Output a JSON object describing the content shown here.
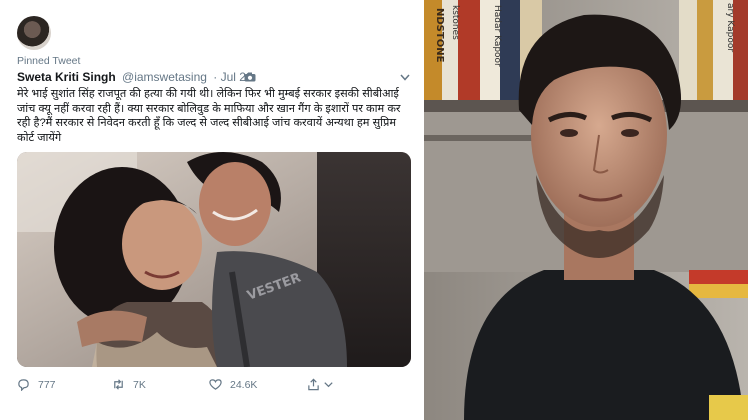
{
  "tweet": {
    "pinned_label": "Pinned Tweet",
    "author_name": "Sweta Kriti Singh",
    "handle": "@iamswetasing",
    "date": "· Jul 28",
    "text": "मेरे भाई सुशांत सिंह राजपूत की हत्या की गयी थी। लेकिन फिर भी मुम्बई सरकार इसकी सीबीआई जांच क्यू नहीं करवा रही हैं। क्या सरकार बोलिवुड के माफिया और खान गैंग के इशारों पर काम कर रही है?मैं सरकार से निवेदन करती हूँ कि जल्द से जल्द सीबीआई जांच करवायें अन्यथा हम सुप्रिम कोर्ट जायेंगे",
    "stats": {
      "replies": "777",
      "retweets": "7K",
      "likes": "24.6K"
    }
  },
  "photo": {
    "shirt_text": "VESTER"
  },
  "bookshelf": {
    "spine_texts": [
      "NDSTONE",
      "kstones",
      "Hadar Kapoor",
      "ary Kapoor"
    ]
  },
  "icons": [
    "avatar",
    "camera-icon",
    "chevron-down-icon",
    "reply-icon",
    "retweet-icon",
    "like-icon",
    "share-icon"
  ],
  "colors": {
    "text": "#14171a",
    "muted": "#657786",
    "background": "#ffffff"
  }
}
